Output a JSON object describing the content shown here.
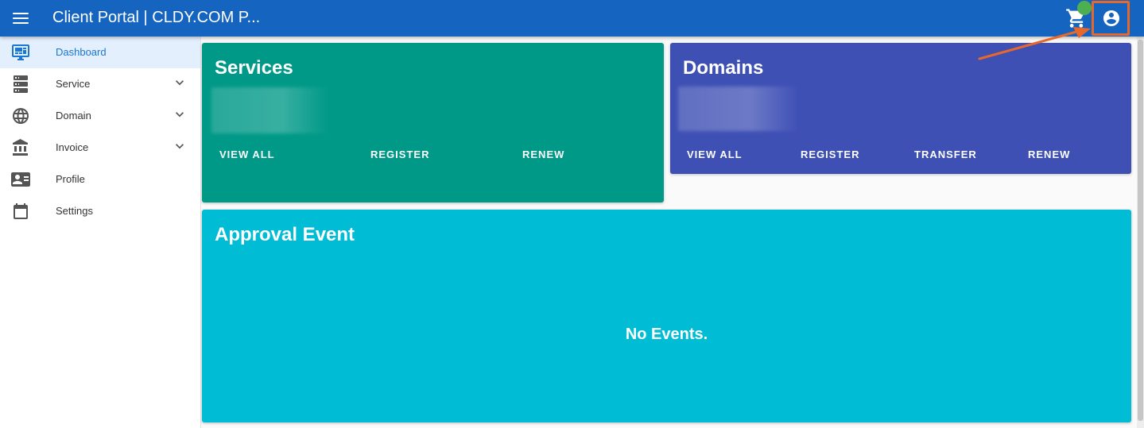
{
  "appbar": {
    "title": "Client Portal | CLDY.COM P...",
    "menu_icon": "hamburger-menu-icon",
    "cart_icon": "cart-icon",
    "account_icon": "account-circle-icon",
    "color": "#1565c0"
  },
  "sidebar": {
    "items": [
      {
        "label": "Dashboard",
        "icon": "monitor-dashboard-icon",
        "active": true
      },
      {
        "label": "Service",
        "icon": "server-icon",
        "expandable": true
      },
      {
        "label": "Domain",
        "icon": "globe-icon",
        "expandable": true
      },
      {
        "label": "Invoice",
        "icon": "bank-icon",
        "expandable": true
      },
      {
        "label": "Profile",
        "icon": "id-card-icon"
      },
      {
        "label": "Settings",
        "icon": "calendar-icon"
      }
    ]
  },
  "cards": {
    "services": {
      "title": "Services",
      "color": "#009987",
      "actions": [
        "VIEW ALL",
        "REGISTER",
        "RENEW"
      ]
    },
    "domains": {
      "title": "Domains",
      "color": "#3f50b5",
      "actions": [
        "VIEW ALL",
        "REGISTER",
        "TRANSFER",
        "RENEW"
      ]
    },
    "approval": {
      "title": "Approval Event",
      "color": "#00bcd5",
      "empty_message": "No Events."
    }
  },
  "colors": {
    "active_nav": "#1976d2",
    "annotation": "#e8672a",
    "cart_badge": "#4caf50"
  }
}
